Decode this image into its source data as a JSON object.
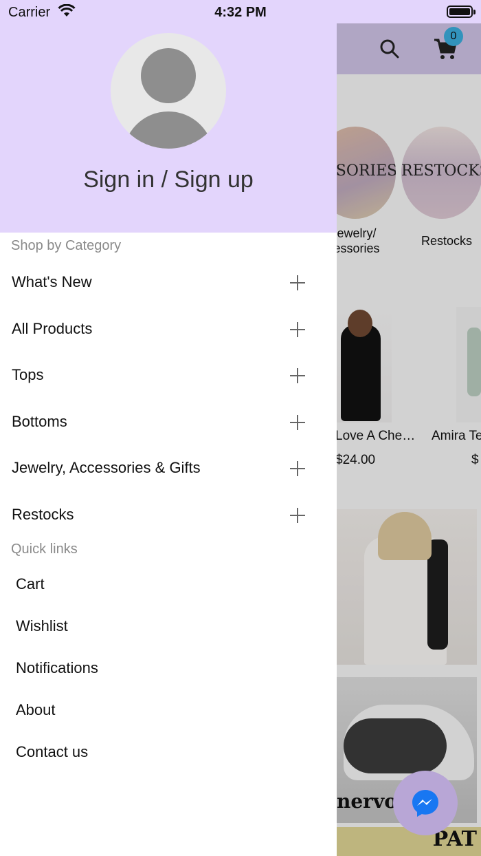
{
  "status_bar": {
    "carrier": "Carrier",
    "time": "4:32 PM"
  },
  "drawer": {
    "sign_in_label": "Sign in / Sign up",
    "shop_by_category_title": "Shop by Category",
    "categories": [
      {
        "label": "What's New"
      },
      {
        "label": "All Products"
      },
      {
        "label": "Tops"
      },
      {
        "label": "Bottoms"
      },
      {
        "label": "Jewelry, Accessories & Gifts"
      },
      {
        "label": "Restocks"
      }
    ],
    "quick_links_title": "Quick links",
    "quick_links": [
      {
        "label": "Cart"
      },
      {
        "label": "Wishlist"
      },
      {
        "label": "Notifications"
      },
      {
        "label": "About"
      },
      {
        "label": "Contact us"
      }
    ]
  },
  "background": {
    "cart_count": "0",
    "categories": [
      {
        "image_text": "ESSORIES",
        "label": "ewelry/ essories"
      },
      {
        "image_text": "RESTOCKS",
        "label": "Restocks"
      }
    ],
    "products": [
      {
        "title": "Love A Che…",
        "price": "$24.00"
      },
      {
        "title": "Amira Te",
        "price": "$"
      }
    ],
    "promo_text": "nervo",
    "promo_text_2": "PAT"
  },
  "colors": {
    "header_purple": "#e3d5fc",
    "badge_blue": "#3aa8d6",
    "messenger_blue": "#1877f2"
  }
}
